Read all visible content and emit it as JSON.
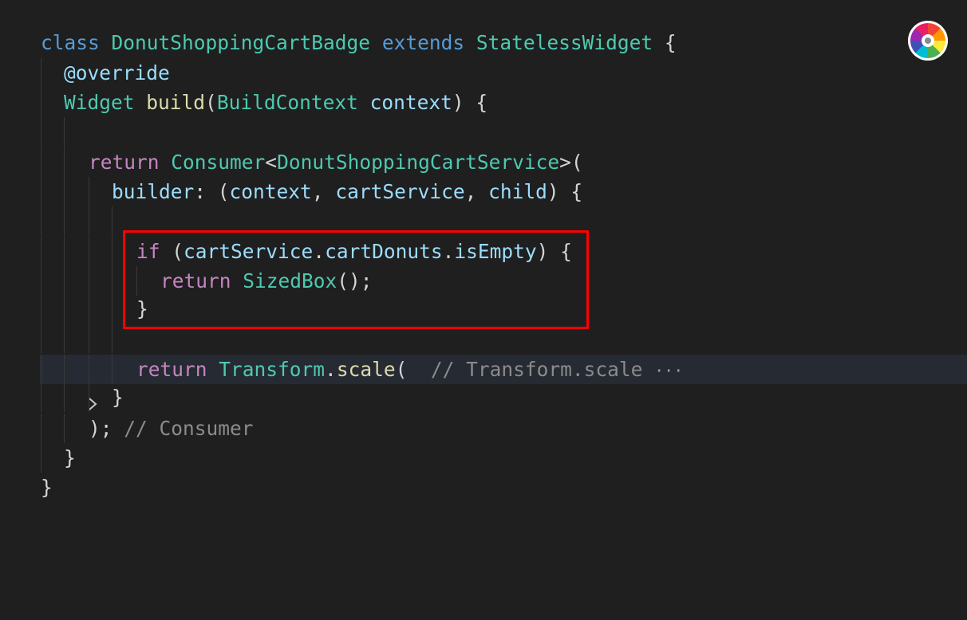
{
  "code": {
    "l1": {
      "kw": "class",
      "name": "DonutShoppingCartBadge",
      "ext": "extends",
      "base": "StatelessWidget",
      "brace": "{"
    },
    "l2": {
      "annotation": "@override"
    },
    "l3": {
      "type": "Widget",
      "fn": "build",
      "open": "(",
      "ptype": "BuildContext",
      "pname": "context",
      "close": ") {"
    },
    "l5": {
      "kw": "return",
      "type": "Consumer",
      "lt": "<",
      "generic": "DonutShoppingCartService",
      "gt": ">("
    },
    "l6": {
      "param": "builder",
      "sep": ": (",
      "a1": "context",
      "c1": ", ",
      "a2": "cartService",
      "c2": ", ",
      "a3": "child",
      "close": ") {"
    },
    "l8": {
      "kw": "if",
      "open": " (",
      "obj": "cartService",
      "d1": ".",
      "prop1": "cartDonuts",
      "d2": ".",
      "prop2": "isEmpty",
      "close": ") {"
    },
    "l9": {
      "kw": "return",
      "type": "SizedBox",
      "tail": "();"
    },
    "l10": {
      "brace": "}"
    },
    "l12": {
      "kw": "return",
      "type": "Transform",
      "dot": ".",
      "fn": "scale",
      "open": "(",
      "comment": "// Transform.scale",
      "ellipsis": "···"
    },
    "l13": {
      "brace": "}"
    },
    "l14": {
      "punct": ");",
      "comment": "// Consumer"
    },
    "l15": {
      "brace": "}"
    },
    "l16": {
      "brace": "}"
    }
  },
  "colors": {
    "background": "#1f1f1f",
    "highlight_box": "#ff0000",
    "keyword": "#569cd6",
    "control": "#c586c0",
    "type": "#4ec9b0",
    "function": "#dcdcaa",
    "variable": "#9cdcfe",
    "comment": "#8b8b8b"
  },
  "icons": {
    "fold": "chevron-right-icon",
    "logo": "color-wheel-logo-icon"
  }
}
